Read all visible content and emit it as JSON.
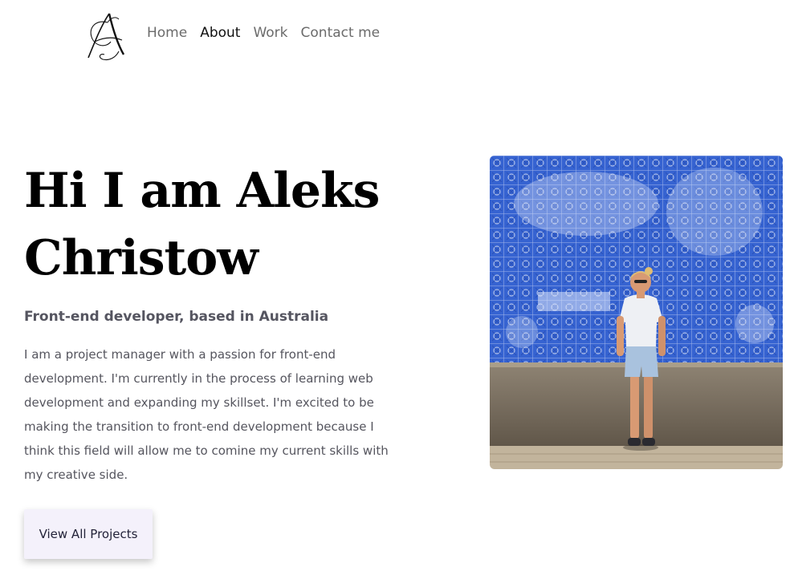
{
  "header": {
    "logo": {
      "icon": "monogram-logo-icon"
    },
    "nav": [
      {
        "label": "Home",
        "active": false
      },
      {
        "label": "About",
        "active": true
      },
      {
        "label": "Work",
        "active": false
      },
      {
        "label": "Contact me",
        "active": false
      }
    ]
  },
  "hero": {
    "title_line1": "Hi I am Aleks",
    "title_line2": "Christow",
    "subtitle": "Front-end developer, based in Australia",
    "bio": "I am a project manager with a passion for front-end development. I'm currently in the process of learning web development and expanding my skillset. I'm excited to be making the transition to front-end development because I think this field will allow me to comine my current skills with my creative side.",
    "cta_label": "View All Projects",
    "photo": {
      "icon": "portrait-photo"
    }
  },
  "colors": {
    "nav_text": "#6b6b6b",
    "nav_active": "#111111",
    "title": "#000000",
    "body_text": "#55555e",
    "button_bg": "#f4f1fb",
    "tile_blue": "#2a58c9"
  }
}
